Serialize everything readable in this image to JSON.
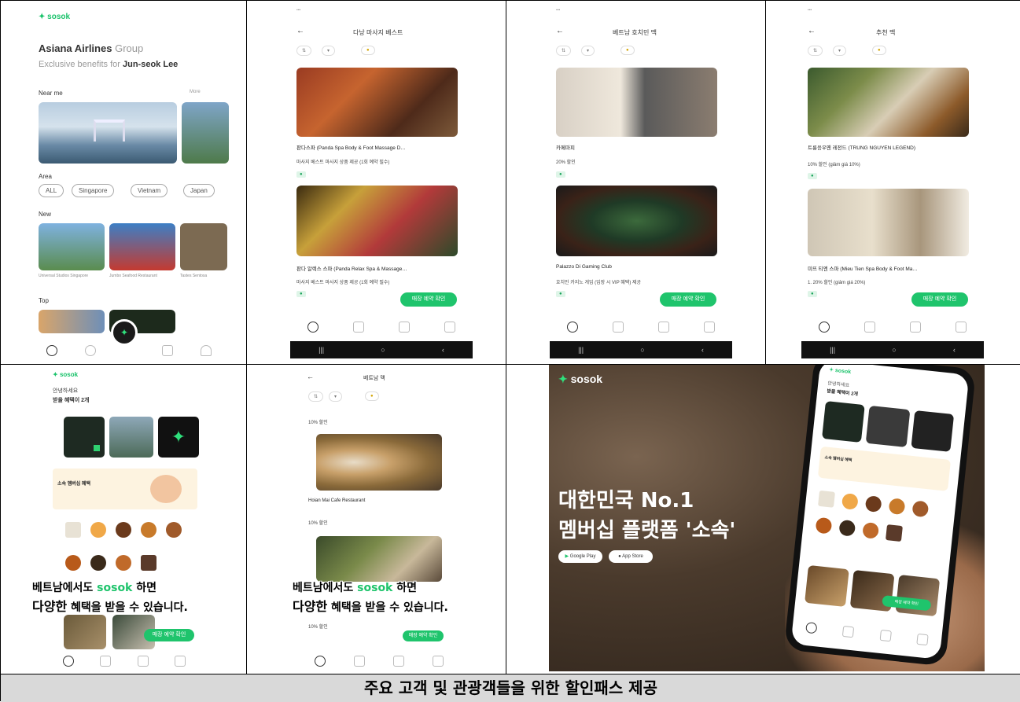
{
  "caption": "주요 고객 및 관광객들을 위한 할인패스 제공",
  "p1": {
    "logo": "sosok",
    "title_main": "Asiana Airlines",
    "title_sub": "Group",
    "subtitle_prefix": "Exclusive benefits for",
    "subtitle_name": "Jun-seok Lee",
    "near_me": "Near me",
    "more": "More",
    "area": "Area",
    "area_pills": [
      "ALL",
      "Singapore",
      "Vietnam",
      "Japan"
    ],
    "new": "New",
    "new_items": [
      "Universal Studios Singapore",
      "Jumbo Seafood Restaurant",
      "Tastes Sentosa"
    ],
    "top": "Top"
  },
  "p2": {
    "header": "다낭 마사지 베스트",
    "items": [
      {
        "title": "판다스파 (Panda Spa Body & Foot Massage D…",
        "sub": "마사지 베스트 마사지 상품 제공 (1회 예약 필수)"
      },
      {
        "title": "판다 알렉스 스파 (Panda Relax Spa & Massage…",
        "sub": "마사지 베스트 마사지 상품 제공 (1회 예약 필수)"
      }
    ],
    "btn": "매장 예약 확인"
  },
  "p3": {
    "header": "베트남 호치민 맥",
    "items": [
      {
        "title": "카페마피",
        "sub": "20% 할인"
      },
      {
        "title": "Palazzo Di Gaming Club",
        "sub": "호치민 카지노 게임 (입장 시 VIP 혜택) 제공"
      }
    ],
    "btn": "매장 예약 확인"
  },
  "p4": {
    "header": "추천 맥",
    "items": [
      {
        "title": "트룽응우옌 레전드 (TRUNG NGUYEN LEGEND)",
        "sub": "10% 할인 (giảm giá 10%)"
      },
      {
        "title": "미뜨 티엔 스파 (Mieu Tien Spa Body & Foot Ma…",
        "sub": "1. 20% 할인 (giảm giá 20%)"
      }
    ],
    "btn": "매장 예약 확인"
  },
  "p5": {
    "logo": "sosok",
    "greet": "안녕하세요",
    "count": "받을 혜택이 2개",
    "banner": "소속 멤버십 혜택",
    "overlay1_a": "베트남에서도",
    "overlay1_brand": "sosok",
    "overlay1_b": "하면",
    "overlay2_a": "다양한",
    "overlay2_b": "혜택을 받을 수 있습니다.",
    "btn": "매장 예약 확인"
  },
  "p6": {
    "header": "베트남 맥",
    "discount": "10% 할인",
    "item_title": "Hoian Mai Cafe Restaurant",
    "btn": "매장 예약 확인"
  },
  "promo": {
    "logo": "sosok",
    "headline1": "대한민국 No.1",
    "headline2": "멤버십 플랫폼 '소속'",
    "store1": "Google Play",
    "store2": "App Store"
  }
}
